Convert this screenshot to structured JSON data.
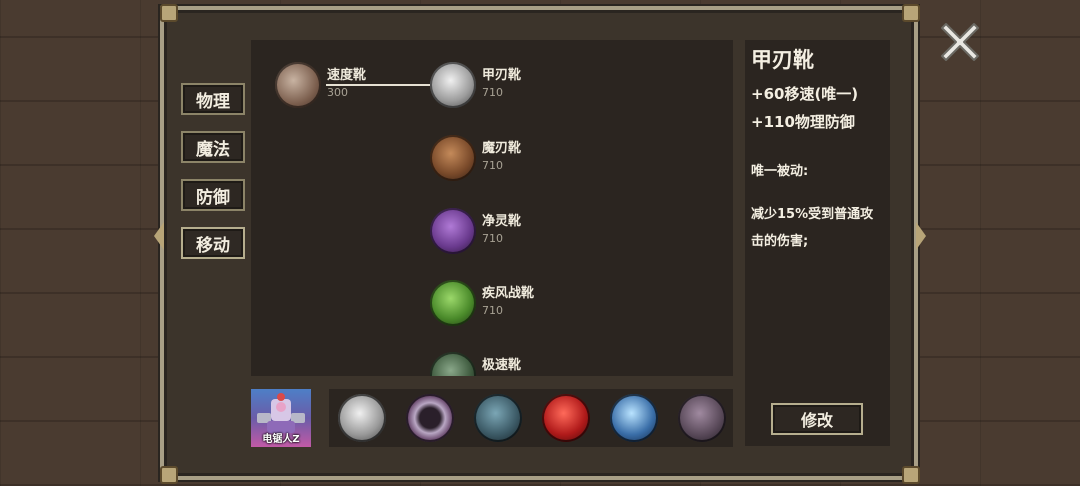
{
  "colors": {
    "panel": "#2b2520",
    "frame": "#3c342b",
    "text": "#f2ede0",
    "muted": "#a8a294"
  },
  "tabs": [
    {
      "label": "物理"
    },
    {
      "label": "魔法"
    },
    {
      "label": "防御"
    },
    {
      "label": "移动"
    }
  ],
  "tree": {
    "root": {
      "name": "速度靴",
      "price": "300"
    },
    "items": [
      {
        "name": "甲刃靴",
        "price": "710"
      },
      {
        "name": "魔刃靴",
        "price": "710"
      },
      {
        "name": "净灵靴",
        "price": "710"
      },
      {
        "name": "疾风战靴",
        "price": "710"
      },
      {
        "name": "极速靴",
        "price": ""
      }
    ]
  },
  "detail": {
    "title": "甲刃靴",
    "stats": [
      "+60移速(唯一)",
      "+110物理防御"
    ],
    "passive_label": "唯一被动:",
    "desc_line1": "减少15%受到普通攻",
    "desc_line2": "击的伤害;"
  },
  "hero": {
    "name": "电锯人Z"
  },
  "modify_label": "修改",
  "equipment_slots": [
    {
      "icon": "armored-boots-icon"
    },
    {
      "icon": "spiked-ring-icon"
    },
    {
      "icon": "dark-axe-icon"
    },
    {
      "icon": "red-crystal-icon"
    },
    {
      "icon": "blue-orb-staff-icon"
    },
    {
      "icon": "dark-armor-icon"
    }
  ]
}
